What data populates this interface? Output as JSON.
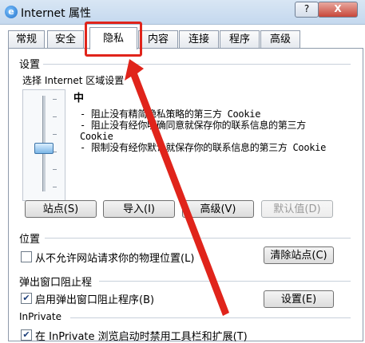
{
  "window": {
    "title": "Internet 属性",
    "help_label": "?",
    "close_label": "X",
    "icon": "ie-globe-icon"
  },
  "tabs": [
    {
      "label": "常规",
      "active": false
    },
    {
      "label": "安全",
      "active": false
    },
    {
      "label": "隐私",
      "active": true
    },
    {
      "label": "内容",
      "active": false
    },
    {
      "label": "连接",
      "active": false
    },
    {
      "label": "程序",
      "active": false
    },
    {
      "label": "高级",
      "active": false
    }
  ],
  "settings": {
    "group_title": "设置",
    "zone_label": "选择 Internet 区域设置",
    "level": "中",
    "descriptions": [
      "- 阻止没有精简隐私策略的第三方 Cookie",
      "- 阻止没有经你明确同意就保存你的联系信息的第三方 Cookie",
      "- 限制没有经你默认就保存你的联系信息的第三方 Cookie"
    ],
    "buttons": {
      "sites": "站点(S)",
      "import": "导入(I)",
      "advanced": "高级(V)",
      "default": "默认值(D)"
    }
  },
  "location": {
    "group_title": "位置",
    "checkbox_label": "从不允许网站请求你的物理位置(L)",
    "checked": false,
    "clear_button": "清除站点(C)"
  },
  "popup": {
    "group_title": "弹出窗口阻止程",
    "checkbox_label": "启用弹出窗口阻止程序(B)",
    "checked": true,
    "settings_button": "设置(E)"
  },
  "inprivate": {
    "group_title": "InPrivate",
    "checkbox_label": "在 InPrivate 浏览启动时禁用工具栏和扩展(T)",
    "checked": true
  },
  "annotation": {
    "color": "#e0241b"
  }
}
